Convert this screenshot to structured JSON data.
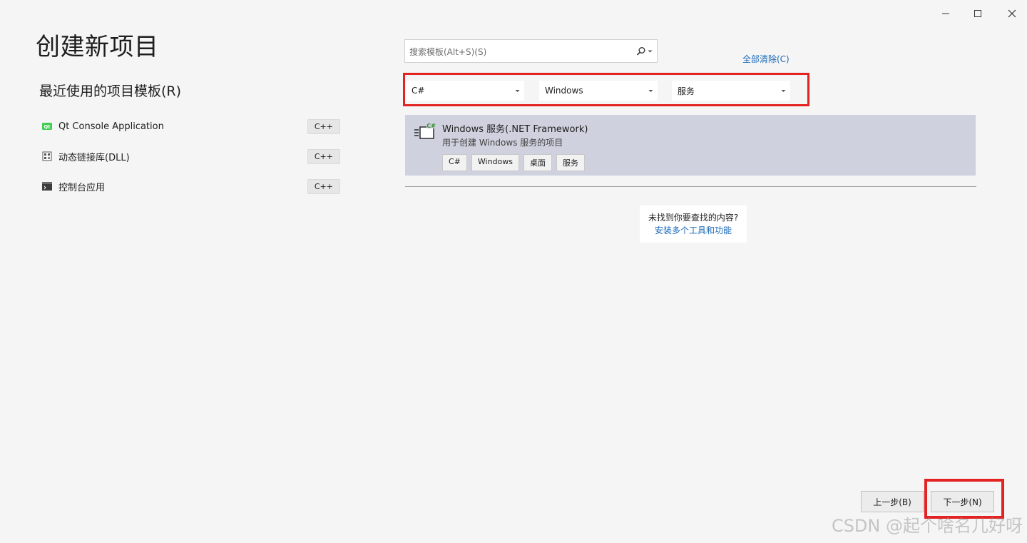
{
  "window": {
    "controls": [
      {
        "name": "minimize",
        "icon": "minimize-icon"
      },
      {
        "name": "maximize",
        "icon": "maximize-icon"
      },
      {
        "name": "close",
        "icon": "close-icon"
      }
    ]
  },
  "page": {
    "title": "创建新项目"
  },
  "recent": {
    "heading": "最近使用的项目模板(R)",
    "items": [
      {
        "label": "Qt Console Application",
        "lang": "C++",
        "icon": "qt-icon"
      },
      {
        "label": "动态链接库(DLL)",
        "lang": "C++",
        "icon": "dll-icon"
      },
      {
        "label": "控制台应用",
        "lang": "C++",
        "icon": "console-icon"
      }
    ]
  },
  "search": {
    "placeholder": "搜索模板(Alt+S)(S)",
    "value": "",
    "icon": "search-icon"
  },
  "clear_all": "全部清除(C)",
  "filters": {
    "language": "C#",
    "platform": "Windows",
    "project_type": "服务"
  },
  "template": {
    "title": "Windows 服务(.NET Framework)",
    "description": "用于创建 Windows 服务的项目",
    "tags": [
      "C#",
      "Windows",
      "桌面",
      "服务"
    ],
    "icon": "csharp-service-icon"
  },
  "not_found": {
    "text": "未找到你要查找的内容?",
    "link": "安装多个工具和功能"
  },
  "buttons": {
    "back": "上一步(B)",
    "next": "下一步(N)"
  },
  "watermark": "CSDN @起个啥名儿好呀",
  "colors": {
    "highlight": "#e32222",
    "link": "#1a69b7",
    "selected": "#cfd1de"
  }
}
